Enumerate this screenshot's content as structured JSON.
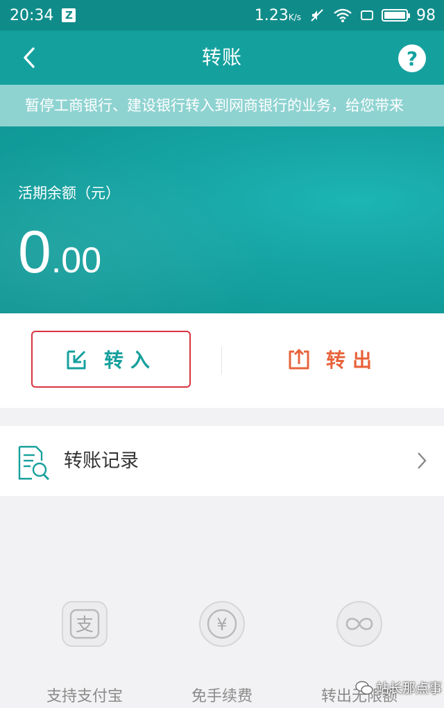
{
  "status_bar": {
    "time": "20:34",
    "notification_badge": "Z",
    "network_speed": "1.23",
    "network_speed_unit": "K/s",
    "battery_level": "98",
    "icons": [
      "z-notification-icon",
      "mute-icon",
      "wifi-icon",
      "sim-icon",
      "battery-icon"
    ]
  },
  "nav": {
    "title": "转账",
    "back_icon": "back-arrow-icon",
    "help_label": "?"
  },
  "notice": {
    "text": "暂停工商银行、建设银行转入到网商银行的业务，给您带来"
  },
  "balance": {
    "label": "活期余额（元）",
    "integer": "0",
    "decimal": ".00"
  },
  "actions": {
    "transfer_in_label": "转入",
    "transfer_out_label": "转出",
    "transfer_in_icon": "transfer-in-icon",
    "transfer_out_icon": "transfer-out-icon"
  },
  "records": {
    "label": "转账记录",
    "icon": "document-search-icon"
  },
  "features": [
    {
      "label": "支持支付宝",
      "icon": "alipay-icon"
    },
    {
      "label": "免手续费",
      "icon": "yuan-coin-icon"
    },
    {
      "label": "转出无限额",
      "icon": "infinity-icon"
    }
  ],
  "watermark": {
    "text": "站长那点事"
  },
  "colors": {
    "primary": "#14a19e",
    "status_bar": "#0f8c8a",
    "notice_bg": "#8fd3d1",
    "highlight_border": "#d9333f",
    "transfer_out": "#e8633b"
  }
}
